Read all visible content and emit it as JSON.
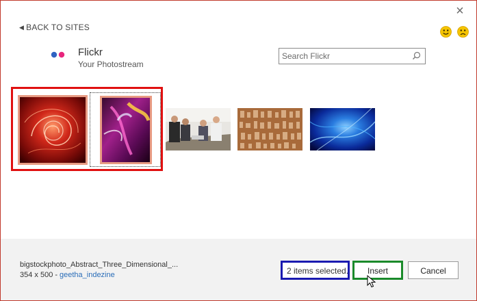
{
  "window": {
    "close_glyph": "×"
  },
  "nav": {
    "back_label": "BACK TO SITES"
  },
  "feedback": {
    "happy_icon": "smiley-happy-icon",
    "sad_icon": "smiley-sad-icon"
  },
  "site": {
    "name": "Flickr",
    "subtitle": "Your Photostream",
    "logo_colors": [
      "#2f63c2",
      "#e8267d"
    ]
  },
  "search": {
    "placeholder": "Search Flickr",
    "value": ""
  },
  "photos": [
    {
      "name": "abstract-red-swirl",
      "selected": true
    },
    {
      "name": "abstract-purple-dancer",
      "selected": true
    },
    {
      "name": "business-meeting",
      "selected": false
    },
    {
      "name": "hieroglyphs",
      "selected": false
    },
    {
      "name": "blue-abstract",
      "selected": false
    }
  ],
  "details": {
    "filename": "bigstockphoto_Abstract_Three_Dimensional_...",
    "dimensions": "354 x 500",
    "separator": "-",
    "author": "geetha_indezine"
  },
  "footer": {
    "selection_count": "2 items selected.",
    "insert_label": "Insert",
    "cancel_label": "Cancel"
  },
  "colors": {
    "selection_red": "#e01010",
    "count_box_blue": "#1a1ab0",
    "insert_box_green": "#1a8a2a",
    "link_blue": "#2a6db8"
  }
}
